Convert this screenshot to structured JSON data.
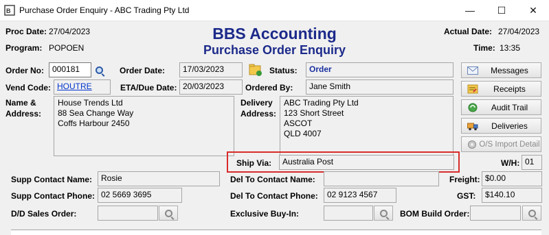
{
  "window": {
    "title": "Purchase Order Enquiry - ABC Trading Pty Ltd",
    "app_icon": "BBS",
    "minimize_glyph": "—",
    "maximize_glyph": "☐",
    "close_glyph": "✕"
  },
  "header": {
    "proc_date_label": "Proc Date:",
    "proc_date": "27/04/2023",
    "program_label": "Program:",
    "program": "POPOEN",
    "brand": "BBS Accounting",
    "screen_title": "Purchase Order Enquiry",
    "actual_date_label": "Actual Date:",
    "actual_date": "27/04/2023",
    "time_label": "Time:",
    "time": "13:35"
  },
  "order": {
    "order_no_label": "Order No:",
    "order_no": "000181",
    "order_date_label": "Order Date:",
    "order_date": "17/03/2023",
    "status_label": "Status:",
    "status": "Order",
    "vend_code_label": "Vend Code:",
    "vend_code": "HOUTRE",
    "eta_label": "ETA/Due Date:",
    "eta": "20/03/2023",
    "ordered_by_label": "Ordered By:",
    "ordered_by": "Jane Smith",
    "name_address_label_1": "Name &",
    "name_address_label_2": "Address:",
    "address_lines": [
      "House Trends Ltd",
      "88 Sea Change Way",
      "Coffs Harbour 2450"
    ],
    "delivery_label_1": "Delivery",
    "delivery_label_2": "Address:",
    "delivery_lines": [
      "ABC Trading Pty Ltd",
      "123 Short Street",
      "ASCOT",
      "QLD 4007"
    ],
    "ship_via_label": "Ship Via:",
    "ship_via": "Australia Post",
    "wh_label": "W/H:",
    "wh": "01"
  },
  "contacts": {
    "supp_contact_name_label": "Supp Contact Name:",
    "supp_contact_name": "Rosie",
    "supp_contact_phone_label": "Supp Contact Phone:",
    "supp_contact_phone": "02 5669 3695",
    "del_contact_name_label": "Del To Contact Name:",
    "del_contact_name": "",
    "del_contact_phone_label": "Del To Contact Phone:",
    "del_contact_phone": "02 9123 4567",
    "freight_label": "Freight:",
    "freight": "$0.00",
    "gst_label": "GST:",
    "gst": "$140.10",
    "dd_sales_order_label": "D/D Sales Order:",
    "dd_sales_order": "",
    "exclusive_buyin_label": "Exclusive Buy-In:",
    "exclusive_buyin": "",
    "bom_build_order_label": "BOM Build Order:",
    "bom_build_order": ""
  },
  "side_buttons": [
    {
      "label": "Messages",
      "icon": "envelope-icon"
    },
    {
      "label": "Receipts",
      "icon": "receipt-icon"
    },
    {
      "label": "Audit Trail",
      "icon": "recycle-icon"
    },
    {
      "label": "Deliveries",
      "icon": "truck-icon"
    },
    {
      "label": "O/S Import Detail",
      "icon": "import-icon"
    }
  ],
  "colors": {
    "brand": "#1c2a8a",
    "highlight": "#d82a2a",
    "link": "#0033cc"
  }
}
